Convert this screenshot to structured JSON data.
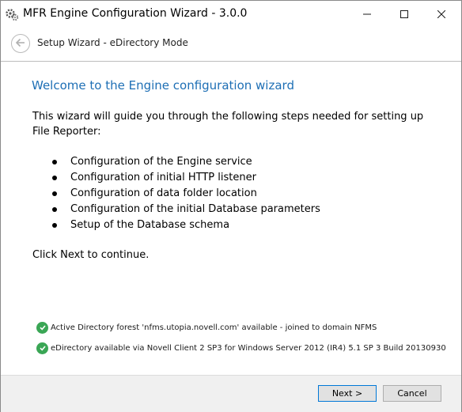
{
  "window": {
    "title": "MFR Engine Configuration Wizard - 3.0.0",
    "app_icon": "gear-cluster-icon",
    "controls": {
      "minimize_icon": "minimize-icon",
      "maximize_icon": "maximize-icon",
      "close_icon": "close-icon"
    }
  },
  "nav": {
    "back_icon": "back-arrow-icon",
    "title": "Setup Wizard - eDirectory Mode"
  },
  "main": {
    "heading": "Welcome to the Engine configuration wizard",
    "intro": "This wizard will guide you through the following steps needed for setting up File Reporter:",
    "steps": [
      "Configuration of the Engine service",
      "Configuration of initial HTTP listener",
      "Configuration of data folder location",
      "Configuration of the initial Database parameters",
      "Setup of the Database schema"
    ],
    "continue_text": "Click Next to continue."
  },
  "status": [
    {
      "icon": "check-circle-icon",
      "text": "Active Directory forest 'nfms.utopia.novell.com' available - joined to domain NFMS"
    },
    {
      "icon": "check-circle-icon",
      "text": "eDirectory available via Novell Client 2 SP3 for Windows Server 2012 (IR4) 5.1 SP 3 Build 20130930"
    }
  ],
  "footer": {
    "next_label": "Next >",
    "cancel_label": "Cancel"
  },
  "colors": {
    "heading": "#1e6fb5",
    "check": "#3aa655",
    "footer_bg": "#f0f0f0"
  }
}
